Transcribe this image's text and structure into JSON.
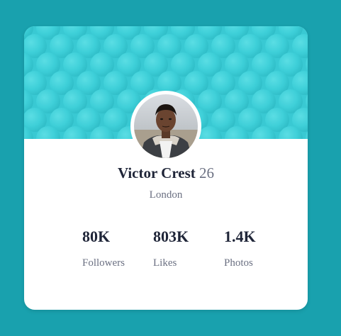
{
  "colors": {
    "page_background": "#19a1ae",
    "banner": "#39c9d3",
    "name_text": "#1f2538",
    "muted_text": "#6b7082"
  },
  "profile": {
    "name": "Victor Crest",
    "age": "26",
    "location": "London",
    "avatar_icon": "profile-photo"
  },
  "stats": [
    {
      "value": "80K",
      "label": "Followers"
    },
    {
      "value": "803K",
      "label": "Likes"
    },
    {
      "value": "1.4K",
      "label": "Photos"
    }
  ]
}
